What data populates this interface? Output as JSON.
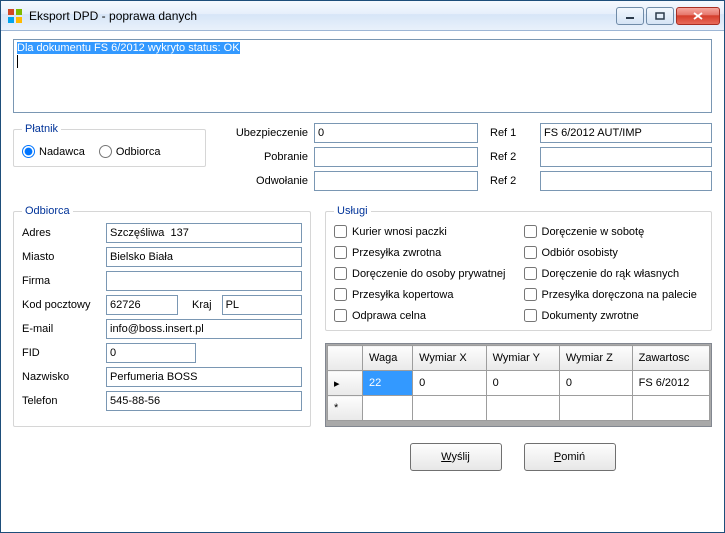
{
  "window": {
    "title": "Eksport DPD - poprawa danych"
  },
  "status": {
    "highlighted": "Dla dokumentu FS 6/2012 wykryto status: OK"
  },
  "payer": {
    "legend": "Płatnik",
    "nadawca_label": "Nadawca",
    "odbiorca_label": "Odbiorca",
    "selected": "nadawca"
  },
  "mid": {
    "ubezpieczenie_label": "Ubezpieczenie",
    "ubezpieczenie_value": "0",
    "pobranie_label": "Pobranie",
    "pobranie_value": "",
    "odwolanie_label": "Odwołanie",
    "odwolanie_value": ""
  },
  "refs": {
    "ref1_label": "Ref 1",
    "ref1_value": "FS 6/2012 AUT/IMP",
    "ref2a_label": "Ref 2",
    "ref2a_value": "",
    "ref2b_label": "Ref 2",
    "ref2b_value": ""
  },
  "recipient": {
    "legend": "Odbiorca",
    "adres_label": "Adres",
    "adres_value": "Szczęśliwa  137",
    "miasto_label": "Miasto",
    "miasto_value": "Bielsko Biała",
    "firma_label": "Firma",
    "firma_value": "",
    "kod_label": "Kod pocztowy",
    "kod_value": "62726",
    "kraj_label": "Kraj",
    "kraj_value": "PL",
    "email_label": "E-mail",
    "email_value": "info@boss.insert.pl",
    "fid_label": "FID",
    "fid_value": "0",
    "nazwisko_label": "Nazwisko",
    "nazwisko_value": "Perfumeria BOSS",
    "telefon_label": "Telefon",
    "telefon_value": "545-88-56"
  },
  "services": {
    "legend": "Usługi",
    "items": [
      {
        "label": "Kurier wnosi paczki",
        "checked": false
      },
      {
        "label": "Doręczenie w sobotę",
        "checked": false
      },
      {
        "label": "Przesyłka zwrotna",
        "checked": false
      },
      {
        "label": "Odbiór osobisty",
        "checked": false
      },
      {
        "label": "Doręczenie do osoby prywatnej",
        "checked": false
      },
      {
        "label": "Doręczenie do rąk własnych",
        "checked": false
      },
      {
        "label": "Przesyłka kopertowa",
        "checked": false
      },
      {
        "label": "Przesyłka doręczona na palecie",
        "checked": false
      },
      {
        "label": "Odprawa celna",
        "checked": false
      },
      {
        "label": "Dokumenty zwrotne",
        "checked": false
      }
    ]
  },
  "grid": {
    "headers": {
      "waga": "Waga",
      "wx": "Wymiar X",
      "wy": "Wymiar Y",
      "wz": "Wymiar Z",
      "zaw": "Zawartosc"
    },
    "rows": [
      {
        "waga": "22",
        "wx": "0",
        "wy": "0",
        "wz": "0",
        "zaw": "FS 6/2012",
        "selected_col": "waga"
      }
    ]
  },
  "buttons": {
    "send": {
      "accel": "W",
      "rest": "yślij"
    },
    "skip": {
      "accel": "P",
      "rest": "omiń"
    }
  }
}
